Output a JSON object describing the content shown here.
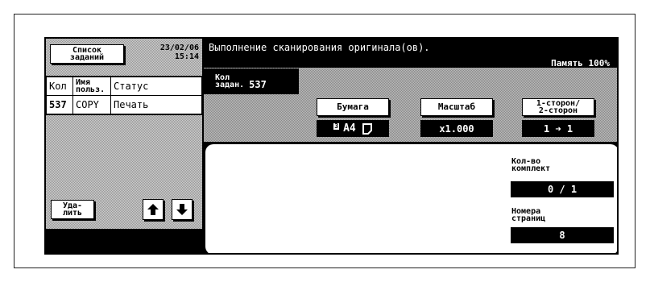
{
  "sidebar": {
    "job_list_button": "Список\nзаданий",
    "date": "23/02/06",
    "time": "15:14",
    "table_headers": [
      "Кол",
      "Имя\nпольз.",
      "Статус"
    ],
    "rows": [
      {
        "count": "537",
        "user": "COPY",
        "status": "Печать"
      }
    ],
    "delete_button": "Уда-\nлить",
    "up_icon": "arrow-up-icon",
    "down_icon": "arrow-down-icon"
  },
  "header": {
    "message": "Выполнение сканирования оригинала(ов).",
    "memory": "Память 100%"
  },
  "job_info": {
    "label": "Кол\nзадан.",
    "number": "537"
  },
  "settings": {
    "paper_label": "Бумага",
    "paper_tray": "3",
    "paper_value": "A4",
    "paper_orientation_icon": "portrait-page-icon",
    "zoom_label": "Масштаб",
    "zoom_value": "x1.000",
    "duplex_label": "1-сторон/\n2-сторон",
    "duplex_value": "1 ➜ 1"
  },
  "status": {
    "sets_label": "Кол-во\nкомплект",
    "sets_value": "0 / 1",
    "pages_label": "Номера\nстраниц",
    "pages_value": "8"
  }
}
